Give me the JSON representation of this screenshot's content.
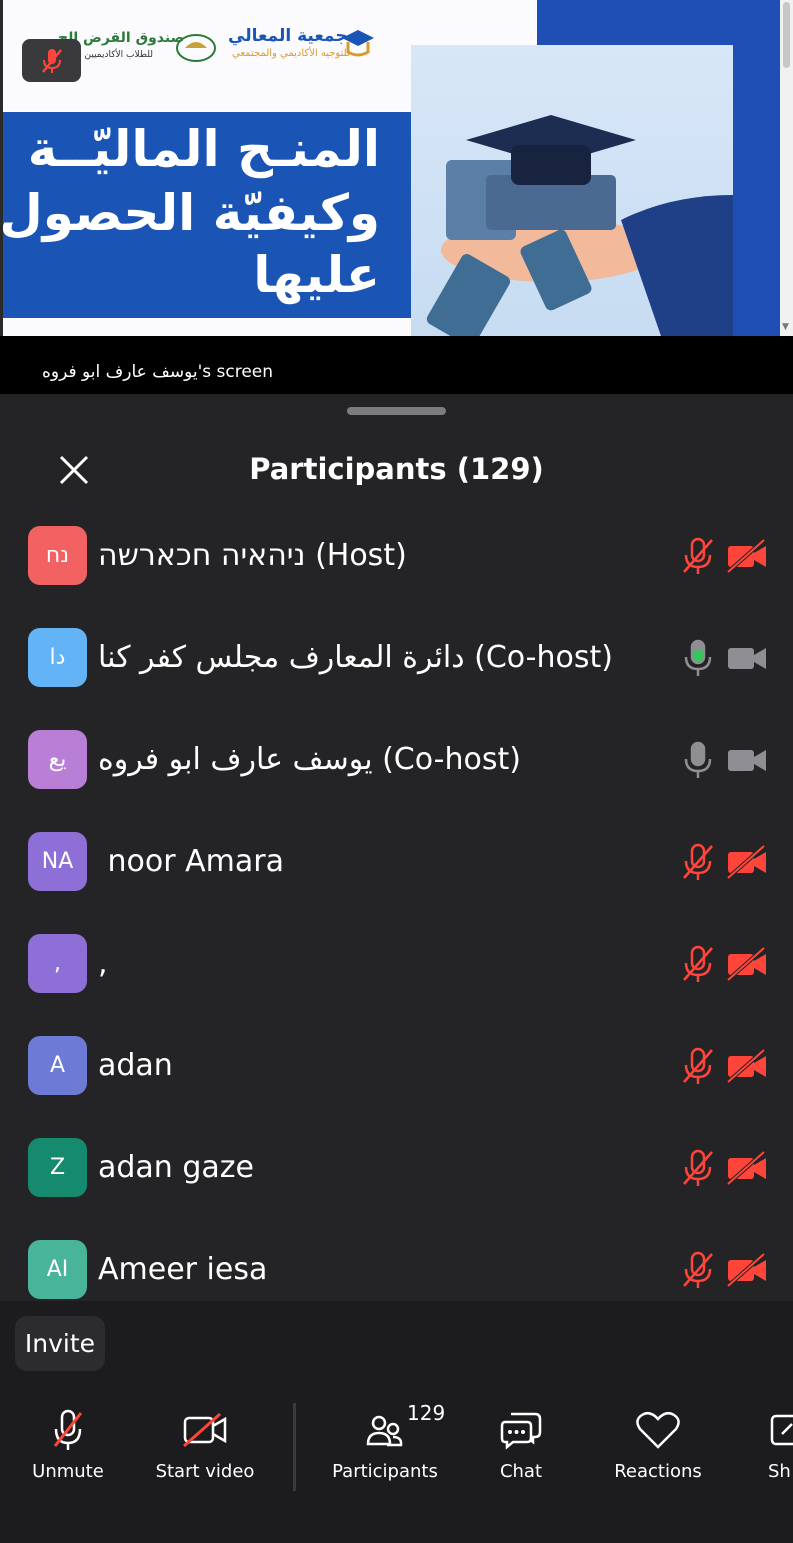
{
  "shared_screen": {
    "headline_lines": [
      "المنـح الماليّــة",
      "وكيفيّة الحصول",
      "عليها"
    ],
    "org_name": "جمعية المعالي",
    "org_subtitle": "للتوجيه الأكاديمي والمجتمعي",
    "fund_name": "صندوق القرض الح",
    "fund_subtitle": "للطلاب الأكاديميين - جمع",
    "sharer_label": "يوسف عارف ابو فروه's screen"
  },
  "participants_panel": {
    "title": "Participants (129)",
    "participants": [
      {
        "initials": "נח",
        "name": "ניהאיה חכארשה (Host)",
        "avatar_color": "#f26262",
        "mic": "muted",
        "video": "off"
      },
      {
        "initials": "دا",
        "name": "دائرة المعارف مجلس كفر كنا (Co-host)",
        "avatar_color": "#62b4f7",
        "mic": "speaking",
        "video": "on"
      },
      {
        "initials": "يع",
        "name": "يوسف عارف ابو فروه (Co-host)",
        "avatar_color": "#b97fd6",
        "mic": "on",
        "video": "on"
      },
      {
        "initials": "NA",
        "name": " noor Amara",
        "avatar_color": "#8e6fd8",
        "mic": "muted",
        "video": "off"
      },
      {
        "initials": ",",
        "name": ",",
        "avatar_color": "#8e6fd8",
        "mic": "muted",
        "video": "off"
      },
      {
        "initials": "A",
        "name": "adan",
        "avatar_color": "#6d7bd6",
        "mic": "muted",
        "video": "off"
      },
      {
        "initials": "Z",
        "name": "adan gaze",
        "avatar_color": "#168a6e",
        "mic": "muted",
        "video": "off"
      },
      {
        "initials": "AI",
        "name": "Ameer iesa",
        "avatar_color": "#48b49a",
        "mic": "muted",
        "video": "off"
      }
    ],
    "invite_label": "Invite"
  },
  "toolbar": {
    "unmute_label": "Unmute",
    "start_video_label": "Start video",
    "participants_label": "Participants",
    "participants_count": "129",
    "chat_label": "Chat",
    "reactions_label": "Reactions",
    "share_label": "Sh"
  },
  "colors": {
    "muted_red": "#ff453a",
    "active_green": "#34c759",
    "inactive_gray": "#8e8e93",
    "sheet_bg": "#242426"
  }
}
